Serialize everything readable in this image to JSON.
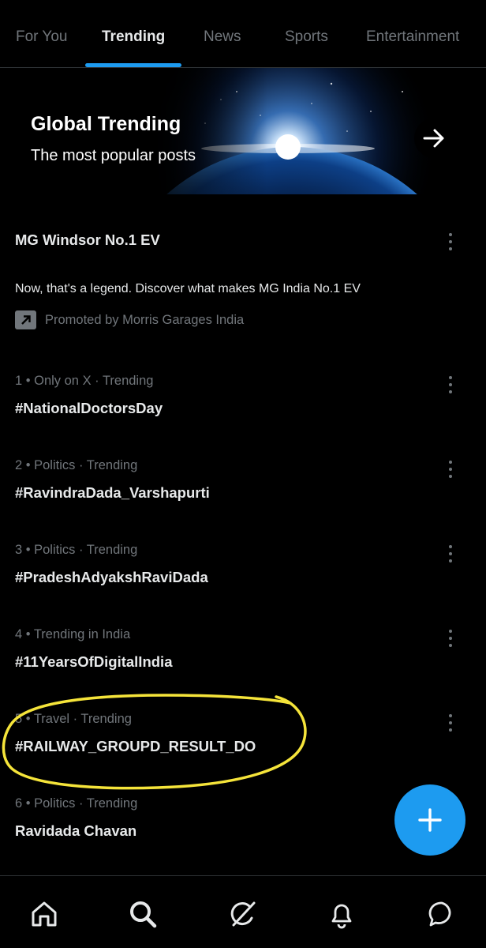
{
  "tabs": [
    {
      "label": "For You"
    },
    {
      "label": "Trending"
    },
    {
      "label": "News"
    },
    {
      "label": "Sports"
    },
    {
      "label": "Entertainment"
    }
  ],
  "active_tab": "Trending",
  "banner": {
    "title": "Global Trending",
    "subtitle": "The most popular posts",
    "arrow_icon": "arrow-right-icon"
  },
  "promoted": {
    "title": "MG Windsor No.1 EV",
    "description": "Now, that's a legend. Discover what makes MG India No.1 EV",
    "promoted_by": "Promoted by Morris Garages India"
  },
  "trends": [
    {
      "meta": "1 • Only on X · Trending",
      "title": "#NationalDoctorsDay"
    },
    {
      "meta": "2 • Politics · Trending",
      "title": "#RavindraDada_Varshapurti"
    },
    {
      "meta": "3 • Politics · Trending",
      "title": "#PradeshAdyakshRaviDada"
    },
    {
      "meta": "4 • Trending in India",
      "title": "#11YearsOfDigitalIndia"
    },
    {
      "meta": "5 • Travel · Trending",
      "title": "#RAILWAY_GROUPD_RESULT_DO"
    },
    {
      "meta": "6 • Politics · Trending",
      "title": "Ravidada Chavan"
    }
  ],
  "fab": {
    "icon": "plus-icon"
  },
  "bottom_nav": [
    {
      "icon": "home-icon"
    },
    {
      "icon": "search-icon"
    },
    {
      "icon": "grok-icon"
    },
    {
      "icon": "bell-icon"
    },
    {
      "icon": "messages-icon"
    }
  ],
  "colors": {
    "accent": "#1d9bf0",
    "background": "#000000",
    "secondary_text": "#71767b",
    "annotation": "#f5e43a"
  }
}
